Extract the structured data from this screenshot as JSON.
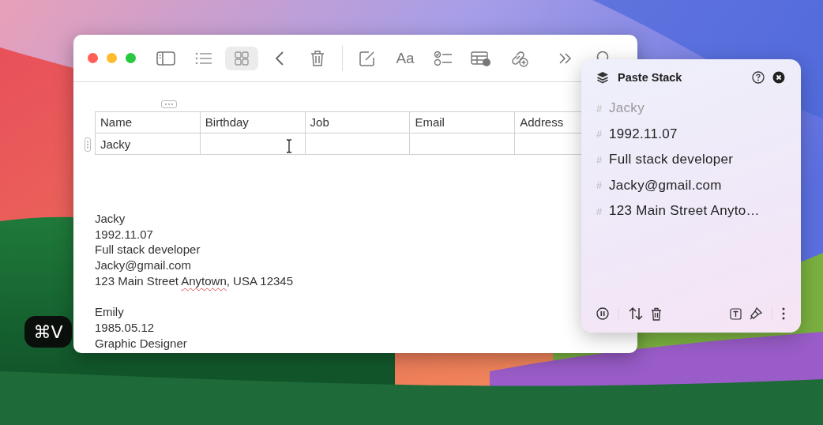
{
  "keystroke_badge": "⌘V",
  "notes_window": {
    "toolbar": {
      "view_buttons": [
        {
          "kind": "list",
          "selected": false
        },
        {
          "kind": "gallery",
          "selected": true
        }
      ],
      "format_label": "Aa"
    },
    "table": {
      "columns": [
        "Name",
        "Birthday",
        "Job",
        "Email",
        "Address"
      ],
      "rows": [
        [
          "Jacky"
        ]
      ]
    },
    "note_blocks": [
      [
        [
          {
            "text": "Jacky"
          }
        ],
        [
          {
            "text": "1992.11.07"
          }
        ],
        [
          {
            "text": "Full stack developer"
          }
        ],
        [
          {
            "text": "Jacky@gmail.com"
          }
        ],
        [
          {
            "text": "123 Main Street "
          },
          {
            "text": "Anytown",
            "misspelled": true
          },
          {
            "text": ", USA 12345"
          }
        ]
      ],
      [
        [
          {
            "text": "Emily"
          }
        ],
        [
          {
            "text": "1985.05.12"
          }
        ],
        [
          {
            "text": "Graphic Designer"
          }
        ]
      ]
    ]
  },
  "paste_stack": {
    "title": "Paste Stack",
    "items": [
      {
        "marker": "#",
        "text": "Jacky",
        "used": true
      },
      {
        "marker": "#",
        "text": "1992.11.07",
        "used": false
      },
      {
        "marker": "#",
        "text": "Full stack developer",
        "used": false
      },
      {
        "marker": "#",
        "text": "Jacky@gmail.com",
        "used": false
      },
      {
        "marker": "#",
        "text": "123 Main Street Anyto…",
        "used": false
      }
    ]
  }
}
